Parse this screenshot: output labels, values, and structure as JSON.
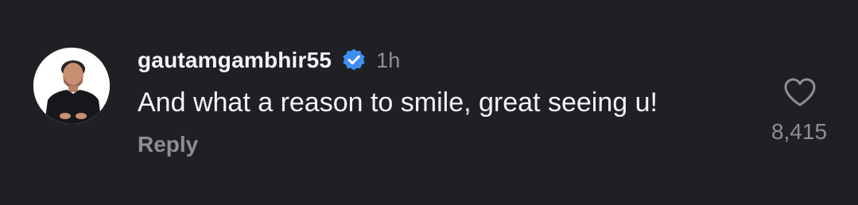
{
  "comment": {
    "avatar_icon": "profile-photo",
    "username": "gautamgambhir55",
    "verified_icon": "verified-badge-icon",
    "verified_color": "#3f8ef6",
    "timestamp": "1h",
    "text": "And what a reason to smile, great seeing u!",
    "reply_label": "Reply",
    "like_icon": "heart-icon",
    "like_count": "8,415"
  },
  "colors": {
    "background": "#1f2024",
    "primary_text": "#f5f5f7",
    "secondary_text": "#8e8f96"
  }
}
